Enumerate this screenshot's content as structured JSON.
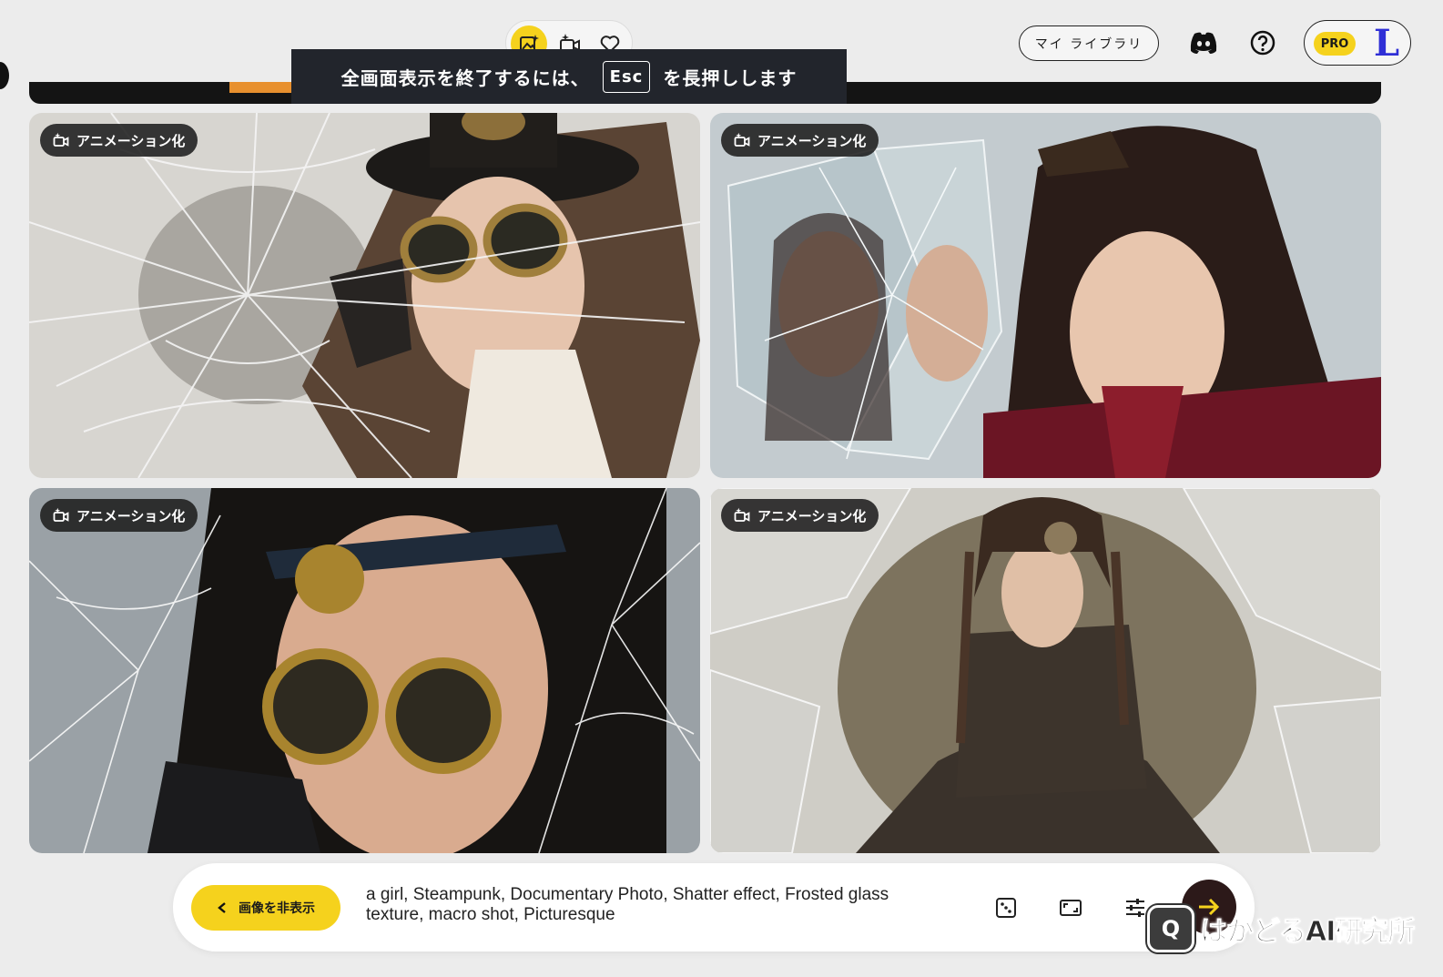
{
  "toolbar": {
    "modes": [
      {
        "icon": "image-sparkle-icon",
        "active": true
      },
      {
        "icon": "video-sparkle-icon",
        "active": false
      },
      {
        "icon": "heart-icon",
        "active": false
      }
    ]
  },
  "toast": {
    "text_before": "全画面表示を終了するには、",
    "key": "Esc",
    "text_after": "を長押しします"
  },
  "header": {
    "library_label": "マイ ライブラリ",
    "discord_icon": "discord-icon",
    "help_icon": "help-icon",
    "pro_label": "PRO",
    "avatar_letter": "L",
    "accent_color": "#f5d21d"
  },
  "gallery": {
    "cards": [
      {
        "badge": "アニメーション化",
        "subject": "child with steampunk goggles behind cracked glass"
      },
      {
        "badge": "アニメーション化",
        "subject": "girl beside shattered mirror"
      },
      {
        "badge": "アニメーション化",
        "subject": "woman with gear goggles behind shattered glass"
      },
      {
        "badge": "アニメーション化",
        "subject": "girl with dreadlocks framed by broken glass"
      }
    ]
  },
  "prompt_bar": {
    "hide_label": "画像を非表示",
    "prompt_text": "a girl, Steampunk, Documentary Photo, Shatter effect, Frosted glass texture, macro shot, Picturesque",
    "tools": [
      "style-dice-icon",
      "aspect-ratio-icon",
      "settings-sliders-icon"
    ],
    "send_icon": "arrow-right-icon"
  },
  "watermark": {
    "text": "はかどるAI研究所"
  }
}
